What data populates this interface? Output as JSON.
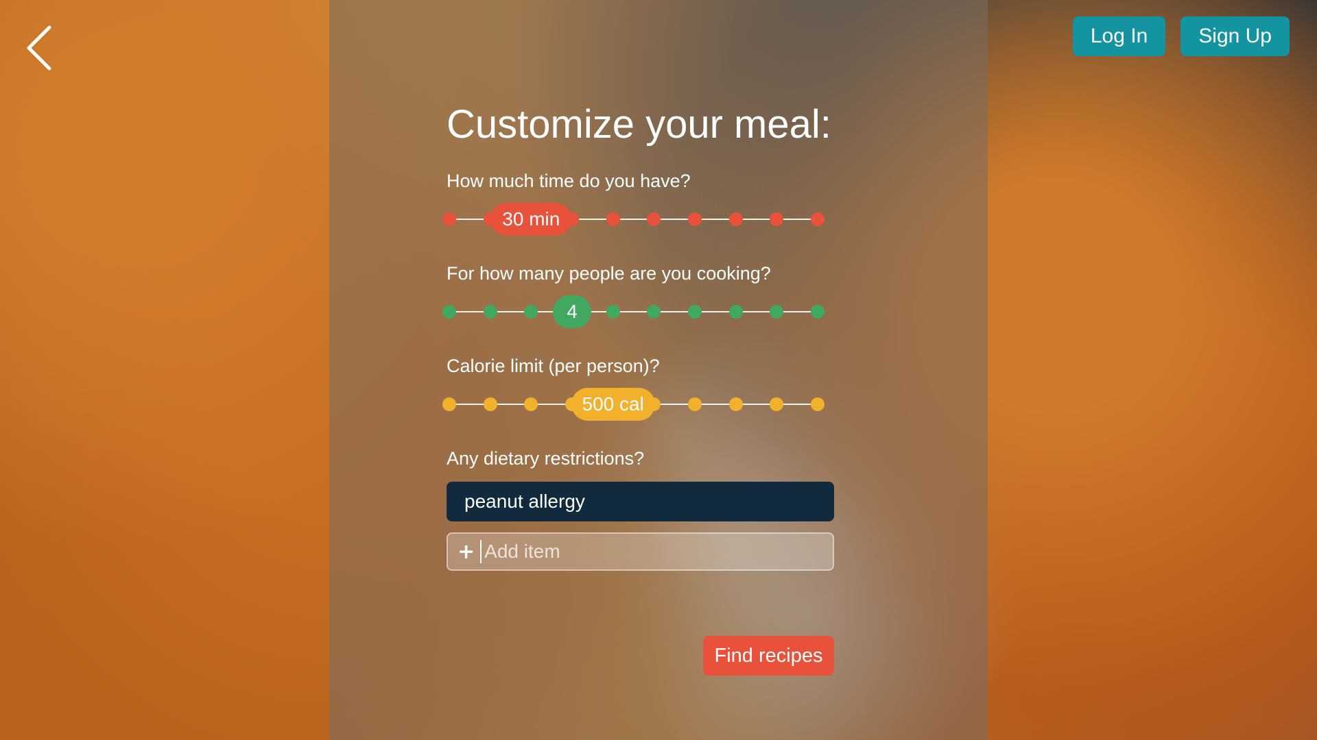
{
  "nav": {
    "back_icon": "chevron-left-icon",
    "login_label": "Log In",
    "signup_label": "Sign Up",
    "button_color": "#1493a0"
  },
  "form": {
    "title": "Customize your meal:",
    "time": {
      "question": "How much time do you have?",
      "value_label": "30 min",
      "selected_index": 2,
      "steps": 10,
      "color": "#e8523a"
    },
    "people": {
      "question": "For how many people are you cooking?",
      "value_label": "4",
      "selected_index": 3,
      "steps": 10,
      "color": "#41a85f"
    },
    "calories": {
      "question": "Calorie limit (per person)?",
      "value_label": "500 cal",
      "selected_index": 4,
      "steps": 10,
      "color": "#f1b12c"
    },
    "diet": {
      "question": "Any dietary restrictions?",
      "items": [
        "peanut allergy"
      ],
      "add_placeholder": "Add item",
      "add_icon": "plus-icon"
    },
    "submit_label": "Find recipes",
    "submit_color": "#e8523a"
  }
}
